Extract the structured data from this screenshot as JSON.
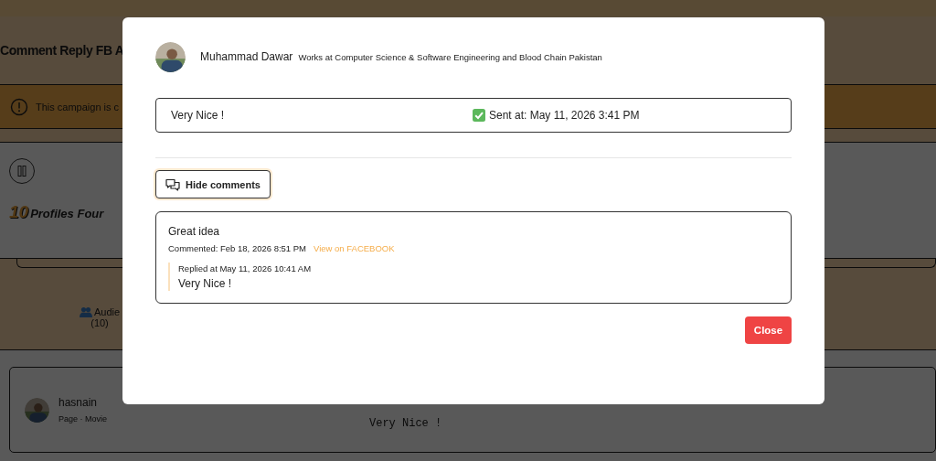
{
  "background_page": {
    "title": "Comment Reply FB A",
    "notice": "This campaign is c",
    "profiles_count": "10",
    "profiles_label": "Profiles Four",
    "audience_label": "Audie",
    "audience_count": "(10)",
    "profile_row": {
      "name": "hasnain",
      "meta": "Page · Movie",
      "reply": "Very Nice !"
    }
  },
  "modal": {
    "user": {
      "name": "Muhammad Dawar",
      "headline": "Works at Computer Science & Software Engineering and Blood Chain Pakistan"
    },
    "message": {
      "text": "Very Nice !",
      "status": "Sent at: May 11, 2026 3:41 PM"
    },
    "toggle_button": "Hide comments",
    "comments": [
      {
        "text": "Great idea",
        "meta": "Commented: Feb 18, 2026 8:51 PM",
        "link": "View on FACEBOOK",
        "replies": [
          {
            "meta": "Replied at May 11, 2026 10:41 AM",
            "text": "Very Nice !"
          }
        ]
      }
    ],
    "close_button": "Close"
  }
}
